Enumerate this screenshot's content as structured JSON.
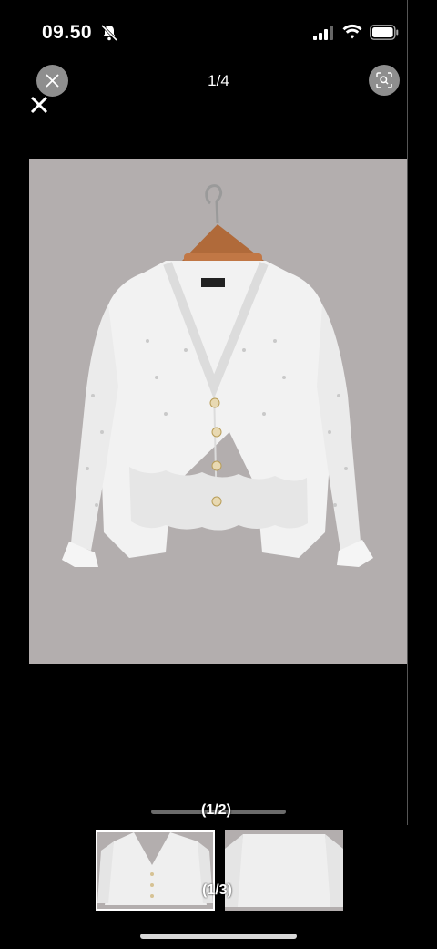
{
  "status_bar": {
    "time": "09.50",
    "icons": [
      "bell-slash-icon",
      "cellular-signal-icon",
      "wifi-icon",
      "battery-icon"
    ]
  },
  "viewer": {
    "counter": "1/4",
    "close_button_icon": "close-icon",
    "lens_button_icon": "visual-search-icon",
    "main_image_subject": "white knit cardigan on hanger"
  },
  "carousel": {
    "page_label": "(1/2)",
    "thumb_label": "(1/3)",
    "thumbnails": [
      "cardigan-front",
      "cardigan-folded"
    ],
    "selected_index": 0
  },
  "colors": {
    "background": "#000000",
    "photo_bg": "#b3aeae",
    "button_bg": "#8e8e8e"
  }
}
